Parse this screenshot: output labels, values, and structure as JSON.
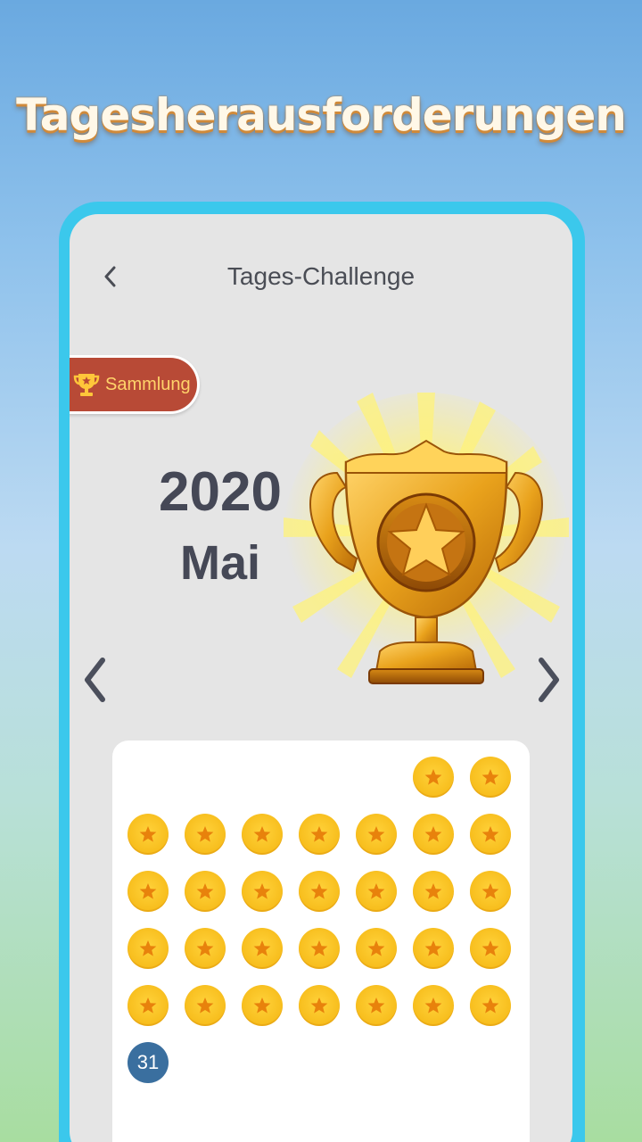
{
  "promo": {
    "title": "Tagesherausforderungen"
  },
  "header": {
    "title": "Tages-Challenge"
  },
  "collection": {
    "label": "Sammlung"
  },
  "period": {
    "year": "2020",
    "month": "Mai"
  },
  "calendar": {
    "leading_blanks": 5,
    "completed_days": [
      1,
      2,
      3,
      4,
      5,
      6,
      7,
      8,
      9,
      10,
      11,
      12,
      13,
      14,
      15,
      16,
      17,
      18,
      19,
      20,
      21,
      22,
      23,
      24,
      25,
      26,
      27,
      28,
      29,
      30
    ],
    "current_day": "31"
  },
  "colors": {
    "frame": "#3bc8ec",
    "screen": "#e5e5e5",
    "coin": "#f7bd1c",
    "coin_star": "#e8820c",
    "collection_bg": "#b84a36",
    "current_day_bg": "#3a6f9f"
  },
  "icons": {
    "back": "chevron-left-icon",
    "collection": "trophy-icon",
    "prev_month": "chevron-left-icon",
    "next_month": "chevron-right-icon",
    "coin": "star-icon"
  }
}
